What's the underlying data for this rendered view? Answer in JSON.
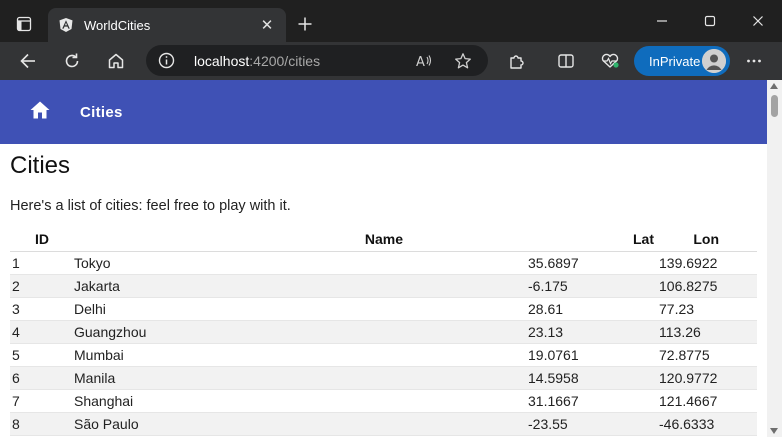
{
  "browser": {
    "tab": {
      "title": "WorldCities"
    },
    "address": {
      "host": "localhost",
      "rest": ":4200/cities"
    },
    "inprivate_label": "InPrivate",
    "accent": "#0f6cbd"
  },
  "app": {
    "toolbar": {
      "nav_label": "Cities",
      "color": "#3f51b5"
    },
    "title": "Cities",
    "intro": "Here's a list of cities: feel free to play with it.",
    "table": {
      "headers": {
        "id": "ID",
        "name": "Name",
        "lat": "Lat",
        "lon": "Lon"
      },
      "rows": [
        {
          "id": "1",
          "name": "Tokyo",
          "lat": "35.6897",
          "lon": "139.6922"
        },
        {
          "id": "2",
          "name": "Jakarta",
          "lat": "-6.175",
          "lon": "106.8275"
        },
        {
          "id": "3",
          "name": "Delhi",
          "lat": "28.61",
          "lon": "77.23"
        },
        {
          "id": "4",
          "name": "Guangzhou",
          "lat": "23.13",
          "lon": "113.26"
        },
        {
          "id": "5",
          "name": "Mumbai",
          "lat": "19.0761",
          "lon": "72.8775"
        },
        {
          "id": "6",
          "name": "Manila",
          "lat": "14.5958",
          "lon": "120.9772"
        },
        {
          "id": "7",
          "name": "Shanghai",
          "lat": "31.1667",
          "lon": "121.4667"
        },
        {
          "id": "8",
          "name": "São Paulo",
          "lat": "-23.55",
          "lon": "-46.6333"
        }
      ]
    }
  },
  "icons": {
    "tab_actions": "tab-actions-icon",
    "favicon": "angular-icon",
    "close": "close-icon",
    "new_tab": "plus-icon",
    "back": "back-arrow-icon",
    "refresh": "refresh-icon",
    "home": "home-icon",
    "info": "info-icon",
    "read_aloud": "read-aloud-icon",
    "favorite": "star-icon",
    "extensions": "puzzle-icon",
    "split": "split-screen-icon",
    "health": "browser-essentials-icon",
    "more": "more-icon"
  }
}
